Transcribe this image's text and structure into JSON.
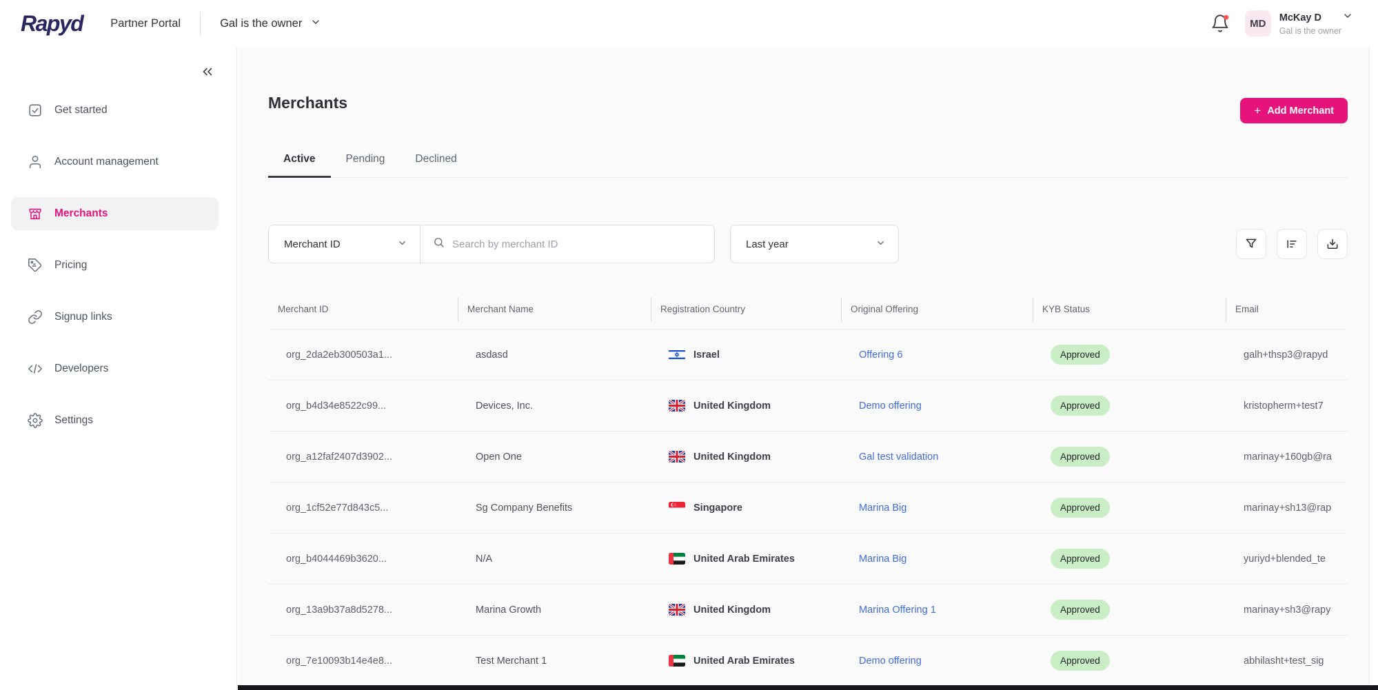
{
  "colors": {
    "accent_pink": "#e6137d",
    "link_blue": "#3f6be0",
    "badge_green_bg": "#c9edc4",
    "logo_navy": "#2a265f",
    "notification_dot": "#f4564e"
  },
  "topbar": {
    "logo_text": "Rapyd",
    "product_title": "Partner Portal",
    "partner_selector": "Gal is the owner",
    "user": {
      "initials": "MD",
      "name": "McKay D",
      "subtitle": "Gal is the owner"
    }
  },
  "sidebar": {
    "items": [
      {
        "label": "Get started",
        "icon": "check-square-icon",
        "active": false
      },
      {
        "label": "Account management",
        "icon": "user-icon",
        "active": false
      },
      {
        "label": "Merchants",
        "icon": "storefront-icon",
        "active": true
      },
      {
        "label": "Pricing",
        "icon": "tag-icon",
        "active": false
      },
      {
        "label": "Signup links",
        "icon": "link-icon",
        "active": false
      },
      {
        "label": "Developers",
        "icon": "code-icon",
        "active": false
      },
      {
        "label": "Settings",
        "icon": "gear-icon",
        "active": false
      }
    ]
  },
  "page": {
    "title": "Merchants",
    "add_button_label": "Add Merchant",
    "add_button_plus": "+",
    "tabs": [
      {
        "label": "Active",
        "active": true
      },
      {
        "label": "Pending",
        "active": false
      },
      {
        "label": "Declined",
        "active": false
      }
    ],
    "filters": {
      "field_selector": "Merchant ID",
      "search_placeholder": "Search by merchant ID",
      "search_value": "",
      "date_range": "Last year"
    },
    "table": {
      "columns": [
        "Merchant ID",
        "Merchant Name",
        "Registration Country",
        "Original Offering",
        "KYB Status",
        "Email"
      ],
      "rows": [
        {
          "id": "org_2da2eb300503a1...",
          "name": "asdasd",
          "country": "Israel",
          "flag": "israel",
          "offering": "Offering 6",
          "kyb": "Approved",
          "email": "galh+thsp3@rapyd"
        },
        {
          "id": "org_b4d34e8522c99...",
          "name": "Devices, Inc.",
          "country": "United Kingdom",
          "flag": "united-kingdom",
          "offering": "Demo offering",
          "kyb": "Approved",
          "email": "kristopherm+test7"
        },
        {
          "id": "org_a12faf2407d3902...",
          "name": "Open One",
          "country": "United Kingdom",
          "flag": "united-kingdom",
          "offering": "Gal test validation",
          "kyb": "Approved",
          "email": "marinay+160gb@ra"
        },
        {
          "id": "org_1cf52e77d843c5...",
          "name": "Sg Company Benefits",
          "country": "Singapore",
          "flag": "singapore",
          "offering": "Marina Big",
          "kyb": "Approved",
          "email": "marinay+sh13@rap"
        },
        {
          "id": "org_b4044469b3620...",
          "name": "N/A",
          "country": "United Arab Emirates",
          "flag": "uae",
          "offering": "Marina Big",
          "kyb": "Approved",
          "email": "yuriyd+blended_te"
        },
        {
          "id": "org_13a9b37a8d5278...",
          "name": "Marina Growth",
          "country": "United Kingdom",
          "flag": "united-kingdom",
          "offering": "Marina Offering 1",
          "kyb": "Approved",
          "email": "marinay+sh3@rapy"
        },
        {
          "id": "org_7e10093b14e4e8...",
          "name": "Test Merchant 1",
          "country": "United Arab Emirates",
          "flag": "uae",
          "offering": "Demo offering",
          "kyb": "Approved",
          "email": "abhilasht+test_sig"
        }
      ]
    }
  }
}
